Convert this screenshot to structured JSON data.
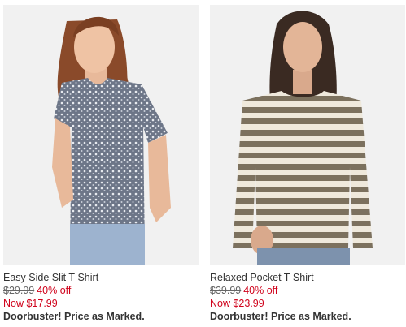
{
  "products": [
    {
      "name": "Easy Side Slit T-Shirt",
      "original_price": "$29.99",
      "discount": "40% off",
      "now_price": "Now $17.99",
      "promo": "Doorbuster! Price as Marked."
    },
    {
      "name": "Relaxed Pocket T-Shirt",
      "original_price": "$39.99",
      "discount": "40% off",
      "now_price": "Now $23.99",
      "promo": "Doorbuster! Price as Marked."
    }
  ],
  "colors": {
    "sale_red": "#d0021b",
    "text": "#333333",
    "strike_gray": "#666666",
    "image_bg": "#f1f1f1"
  }
}
